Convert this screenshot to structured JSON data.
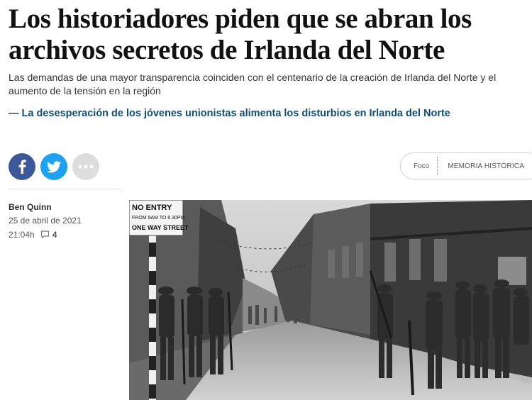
{
  "article": {
    "headline": "Los historiadores piden que se abran los archivos secretos de Irlanda del Norte",
    "standfirst": "Las demandas de una mayor transparencia coinciden con el centenario de la creación de Irlanda del Norte y el aumento de la tensión en la región",
    "related_link": "— La desesperación de los jóvenes unionistas alimenta los disturbios en Irlanda del Norte"
  },
  "share": {
    "icons": [
      "facebook-icon",
      "twitter-icon",
      "more-icon"
    ],
    "colors": {
      "facebook": "#3b5998",
      "twitter": "#1da1f2",
      "more": "#dddddd"
    }
  },
  "tags": {
    "foco": "Foco",
    "topic": "MEMORIA HISTÓRICA"
  },
  "byline": {
    "author": "Ben Quinn",
    "date": "25 de abril de 2021",
    "time": "21:04h",
    "comment_count": "4"
  },
  "photo": {
    "sign_line1": "NO ENTRY",
    "sign_line2": "FROM 9AM TO 6.30PM",
    "sign_line3": "ONE WAY STREET"
  }
}
